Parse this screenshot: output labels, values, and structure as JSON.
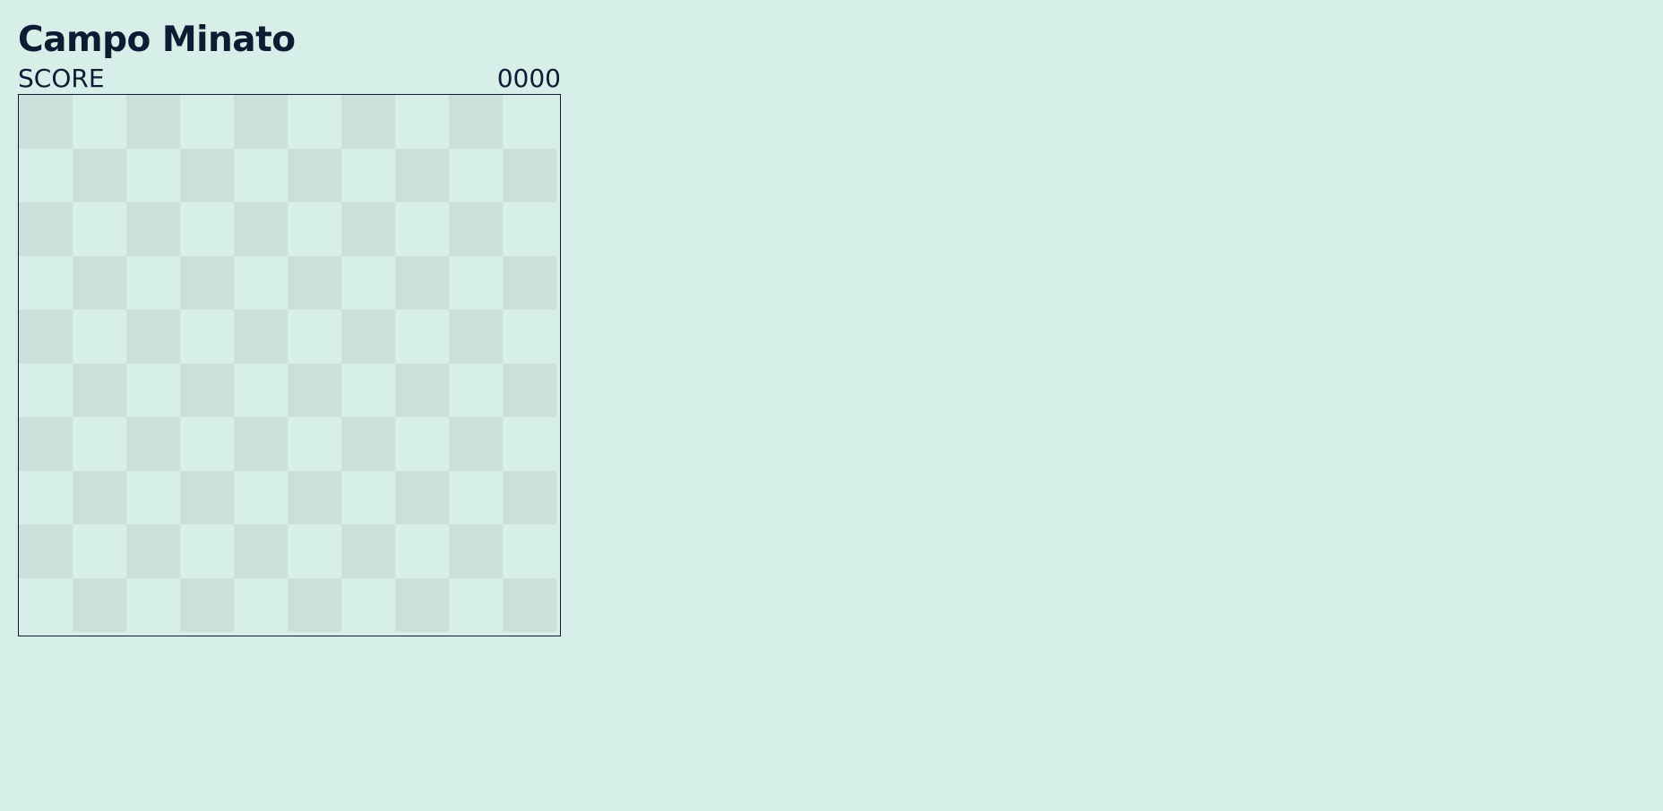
{
  "header": {
    "title": "Campo Minato"
  },
  "score": {
    "label": "SCORE",
    "value": "0000"
  },
  "board": {
    "rows": 10,
    "cols": 10,
    "colors": {
      "dark": "#cae0db",
      "light": "#d7efe9",
      "border": "#0d1b33"
    }
  }
}
